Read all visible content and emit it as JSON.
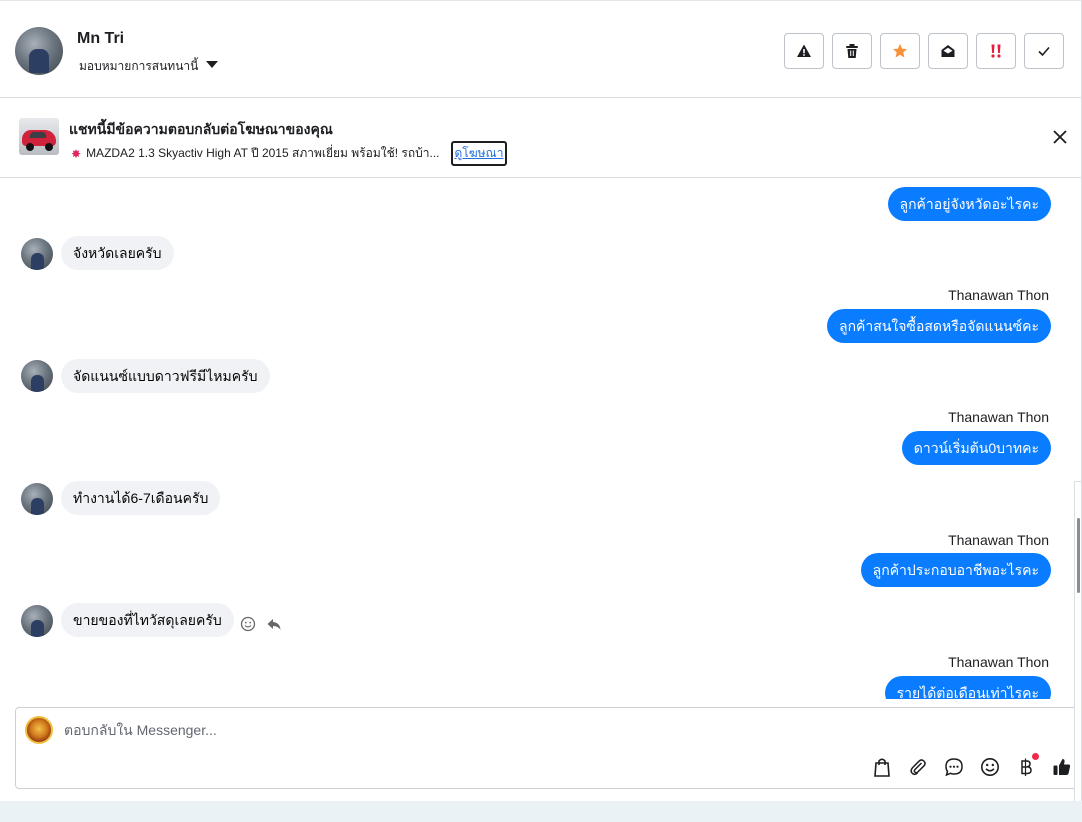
{
  "header": {
    "name": "Mn Tri",
    "assign_label": "มอบหมายการสนทนานี้"
  },
  "actions": [
    {
      "name": "report-button",
      "icon": "warning-icon"
    },
    {
      "name": "delete-button",
      "icon": "trash-icon"
    },
    {
      "name": "star-button",
      "icon": "star-icon"
    },
    {
      "name": "mark-unread-button",
      "icon": "envelope-open-icon"
    },
    {
      "name": "priority-button",
      "icon": "exclamation-icon"
    },
    {
      "name": "done-button",
      "icon": "check-icon"
    }
  ],
  "ad": {
    "title": "แชทนี้มีข้อความตอบกลับต่อโฆษณาของคุณ",
    "description": "MAZDA2 1.3 Skyactiv High AT ปี 2015 สภาพเยี่ยม พร้อมใช้! รถบ้า...",
    "link_label": "ดูโฆษณา"
  },
  "messages": {
    "m1": "ลูกค้าอยู่จังหวัดอะไรคะ",
    "m2": "จังหวัดเลยครับ",
    "m3_sender": "Thanawan Thon",
    "m3": "ลูกค้าสนใจซื้อสดหรือจัดแนนซ์คะ",
    "m4": "จัดแนนซ์แบบดาวฟรีมีไหมครับ",
    "m5_sender": "Thanawan Thon",
    "m5": "ดาวน์เริ่มต้น0บาทคะ",
    "m6": "ทำงานได้6-7เดือนครับ",
    "m7_sender": "Thanawan Thon",
    "m7": "ลูกค้าประกอบอาชีพอะไรคะ",
    "m8": "ขายของที่ไทวัสดุเลยครับ",
    "m9_sender": "Thanawan Thon",
    "m9": "รายได้ต่อเดือนเท่าไรคะ"
  },
  "composer": {
    "placeholder": "ตอบกลับใน Messenger..."
  },
  "colors": {
    "outgoing_bubble": "#0a7cff",
    "incoming_bubble": "#f0f2f5",
    "star": "#f7923a",
    "priority": "#e41e3f",
    "link": "#216fdb"
  }
}
